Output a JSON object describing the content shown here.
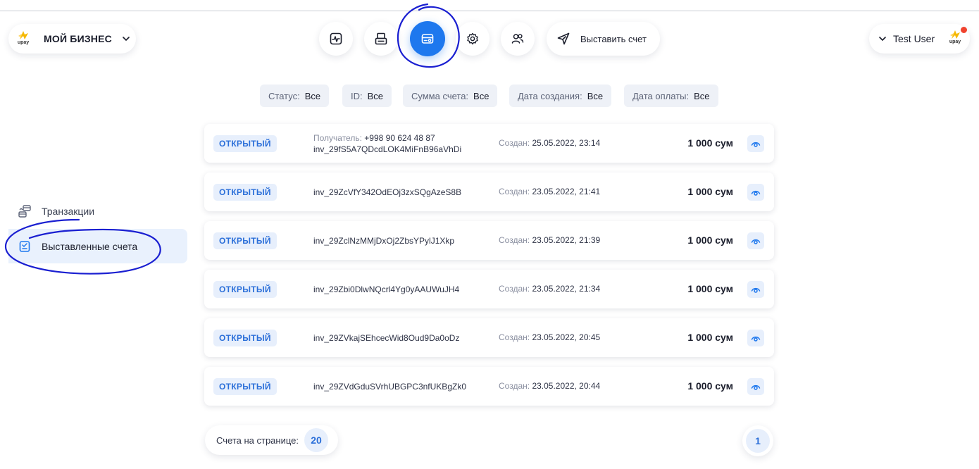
{
  "brand": {
    "logo_text": "upay",
    "logo_color": "#f5b800"
  },
  "business": {
    "name": "МОЙ БИЗНЕС",
    "icon": "chevron-down-icon"
  },
  "nav": {
    "items": [
      {
        "name": "analytics",
        "icon": "chart-icon"
      },
      {
        "name": "terminals",
        "icon": "printer-icon"
      },
      {
        "name": "invoices",
        "icon": "invoice-card-icon",
        "active": true
      },
      {
        "name": "settings",
        "icon": "gear-icon"
      },
      {
        "name": "users",
        "icon": "users-icon"
      }
    ],
    "send_label": "Выставить счет",
    "accent": "#1e78ee"
  },
  "user": {
    "name": "Test User",
    "notification_color": "#f0422e"
  },
  "filters": [
    {
      "label": "Статус:",
      "value": "Все"
    },
    {
      "label": "ID:",
      "value": "Все"
    },
    {
      "label": "Сумма счета:",
      "value": "Все"
    },
    {
      "label": "Дата создания:",
      "value": "Все"
    },
    {
      "label": "Дата оплаты:",
      "value": "Все"
    }
  ],
  "sidebar": {
    "items": [
      {
        "label": "Транзакции",
        "icon": "transactions-icon"
      },
      {
        "label": "Выставленные счета",
        "icon": "invoice-list-icon",
        "active": true
      }
    ]
  },
  "invoices": [
    {
      "status": "ОТКРЫТЫЙ",
      "recipient_label": "Получатель:",
      "recipient": "+998 90 624 48 87",
      "id": "inv_29fS5A7QDcdLOK4MiFnB96aVhDi",
      "created_label": "Создан:",
      "created": "25.05.2022, 23:14",
      "amount": "1 000 сум"
    },
    {
      "status": "ОТКРЫТЫЙ",
      "id": "inv_29ZcVfY342OdEOj3zxSQgAzeS8B",
      "created_label": "Создан:",
      "created": "23.05.2022, 21:41",
      "amount": "1 000 сум"
    },
    {
      "status": "ОТКРЫТЫЙ",
      "id": "inv_29ZclNzMMjDxOj2ZbsYPylJ1Xkp",
      "created_label": "Создан:",
      "created": "23.05.2022, 21:39",
      "amount": "1 000 сум"
    },
    {
      "status": "ОТКРЫТЫЙ",
      "id": "inv_29Zbi0DlwNQcrl4Yg0yAAUWuJH4",
      "created_label": "Создан:",
      "created": "23.05.2022, 21:34",
      "amount": "1 000 сум"
    },
    {
      "status": "ОТКРЫТЫЙ",
      "id": "inv_29ZVkajSEhcecWid8Oud9Da0oDz",
      "created_label": "Создан:",
      "created": "23.05.2022, 20:45",
      "amount": "1 000 сум"
    },
    {
      "status": "ОТКРЫТЫЙ",
      "id": "inv_29ZVdGduSVrhUBGPC3nfUKBgZk0",
      "created_label": "Создан:",
      "created": "23.05.2022, 20:44",
      "amount": "1 000 сум"
    }
  ],
  "pagination": {
    "per_page_label": "Счета на странице:",
    "per_page": "20",
    "page": "1"
  }
}
